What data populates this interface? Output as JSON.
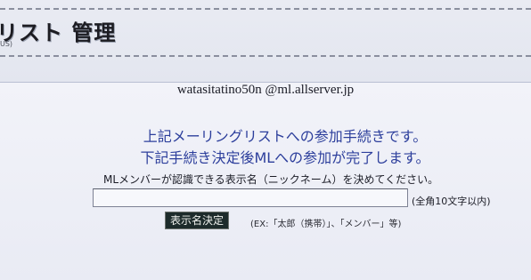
{
  "header": {
    "title": "リスト 管理",
    "subtitle": "US)"
  },
  "list": {
    "address": "watasitatino50n @ml.allserver.jp"
  },
  "intro": {
    "line1": "上記メーリングリストへの参加手続きです。",
    "line2": "下記手続き決定後MLへの参加が完了します。"
  },
  "form": {
    "instruction": "MLメンバーが認識できる表示名（ニックネーム）を決めてください。",
    "nickname_value": "",
    "nickname_hint": "(全角10文字以内)",
    "submit_label": "表示名決定",
    "example": "(EX:「太郎（携帯）」、「メンバー」等)"
  }
}
